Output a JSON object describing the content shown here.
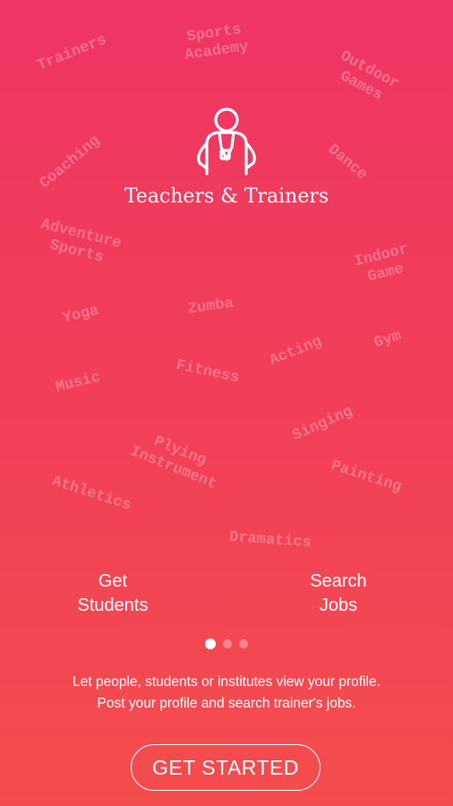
{
  "background_words": [
    {
      "text": "Trainers"
    },
    {
      "text": "Sports\nAcademy"
    },
    {
      "text": "Outdoor\nGames"
    },
    {
      "text": "Coaching"
    },
    {
      "text": "Dance"
    },
    {
      "text": "Adventure\nSports"
    },
    {
      "text": "Indoor\nGame"
    },
    {
      "text": "Yoga"
    },
    {
      "text": "Zumba"
    },
    {
      "text": "Gym"
    },
    {
      "text": "Acting"
    },
    {
      "text": "Music"
    },
    {
      "text": "Fitness"
    },
    {
      "text": "Singing"
    },
    {
      "text": "Plying\nInstrument"
    },
    {
      "text": "Painting"
    },
    {
      "text": "Athletics"
    },
    {
      "text": "Dramatics"
    }
  ],
  "brand": {
    "title": "Teachers & Trainers",
    "icon": "trainer-icon"
  },
  "features": {
    "left": "Get\nStudents",
    "right": "Search\nJobs"
  },
  "pager": {
    "total": 3,
    "active": 1
  },
  "description": {
    "line1": "Let people, students or institutes view your profile.",
    "line2": "Post your profile and search trainer's jobs."
  },
  "cta": {
    "label": "GET STARTED"
  },
  "colors": {
    "gradient_top": "#ef3563",
    "gradient_bottom": "#f44d4d",
    "text": "#ffffff"
  }
}
